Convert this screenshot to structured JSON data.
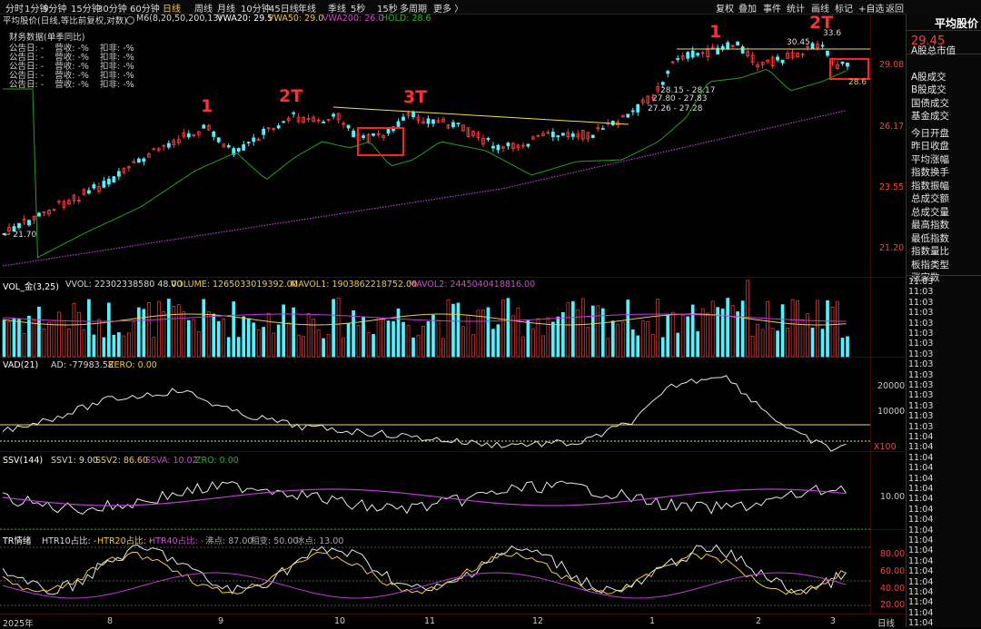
{
  "toolbar": {
    "periods": [
      "分时",
      "1分钟",
      "5分钟",
      "15分钟",
      "30分钟",
      "60分钟",
      "日线",
      "周线",
      "月线",
      "10分钟",
      "45日线",
      "年线",
      "季线",
      "5秒",
      "15秒",
      "多周期",
      "更多 〉"
    ],
    "active_period": "日线",
    "right_tools": [
      "复权",
      "叠加",
      "事件",
      "统计",
      "画线",
      "标记",
      "+自选",
      "返回"
    ]
  },
  "title_line": {
    "name": "平均股价(日线,等比前复权,对数)",
    "ma_label": "M6(8,20,50,200,13)",
    "vwa20": "VWA20: 29.5",
    "vwa50": "VWA50: 29.0",
    "vwa200": "VWA200: 26.0",
    "hold": "HOLD: 28.6"
  },
  "financial": {
    "title": "财务数据(单季同比)",
    "rows": [
      "公告日: -    营收: -%    扣非: -%",
      "公告日: -    营收: -%    扣非: -%",
      "公告日: -    营收: -%    扣非: -%",
      "公告日: -    营收: -%    扣非: -%",
      "公告日: -    营收: -%    扣非: -%"
    ]
  },
  "price_axis": [
    "29.08",
    "26.17",
    "23.55",
    "21.20"
  ],
  "price_annotations": {
    "low": "← 21.70",
    "high_top": "33.6",
    "high": "30.45",
    "hold_price": "28.6",
    "levels": [
      "28.15 - 28.17",
      "27.80 - 27.83",
      "27.26 - 27.28"
    ]
  },
  "marks": [
    "1",
    "2T",
    "3T",
    "1",
    "2T"
  ],
  "vol_panel": {
    "label": "VOL_金(3,25)",
    "vvol": "VVOL: 22302338580 48.00",
    "volume": "VOLUME: 1265033019392.00",
    "mavol1": "MAVOL1: 1903862218752.00",
    "mavol2": "MAVOL2: 2445040418816.00"
  },
  "vad_panel": {
    "label": "VAD(21)",
    "ad": "AD: -77983.58",
    "zero": "ZERO: 0.00",
    "ticks": [
      "20000",
      "10000"
    ],
    "unit": "X100"
  },
  "ssv_panel": {
    "label": "SSV(144)",
    "ssv1": "SSV1: 9.00",
    "ssv2": "SSV2: 86.60",
    "ssva": "SSVA: 10.02",
    "zro": "ZRO: 0.00",
    "ticks": [
      "10.00"
    ]
  },
  "tr_panel": {
    "label": "TR情绪",
    "htr10": "HTR10占比: -",
    "htr20": "HTR20占比: -",
    "htr40": "HTR40占比: -",
    "boil": "沸点: 87.00",
    "phase": "相变: 50.00",
    "freeze": "冰点: 13.00",
    "ticks": [
      "80.00",
      "60.00",
      "40.00",
      "20.00"
    ]
  },
  "x_axis": [
    "2025年",
    "8",
    "9",
    "10",
    "11",
    "12",
    "1",
    "2",
    "3"
  ],
  "x_unit": "日线",
  "right_panel": {
    "title": "平均股价",
    "price": "29.45",
    "items": [
      "A股总市值",
      "A股成交",
      "B股成交",
      "国债成交",
      "基金成交",
      "今日开盘",
      "昨日收盘",
      "平均涨幅",
      "指数换手",
      "指数振幅",
      "总成交额",
      "总成交量",
      "最高指数",
      "最低指数",
      "指数量比",
      "板指类型",
      "涨家数"
    ],
    "times": [
      "11:03",
      "11:03",
      "11:03",
      "11:03",
      "11:03",
      "11:03",
      "11:03",
      "11:03",
      "11:03",
      "11:03",
      "11:03",
      "11:03",
      "11:03",
      "11:03",
      "11:03",
      "11:04",
      "11:04",
      "11:04",
      "11:04",
      "11:04",
      "11:04",
      "11:04",
      "11:04",
      "11:04",
      "11:04",
      "11:04",
      "11:04",
      "11:04",
      "11:04",
      "11:04",
      "11:04",
      "11:04",
      "11:04",
      "11:04"
    ]
  },
  "colors": {
    "up": "#ff3b3b",
    "down": "#54f0ff",
    "ma_green": "#1fa31f",
    "ma_purple": "#c23bd8",
    "yellow": "#f2e33a"
  }
}
